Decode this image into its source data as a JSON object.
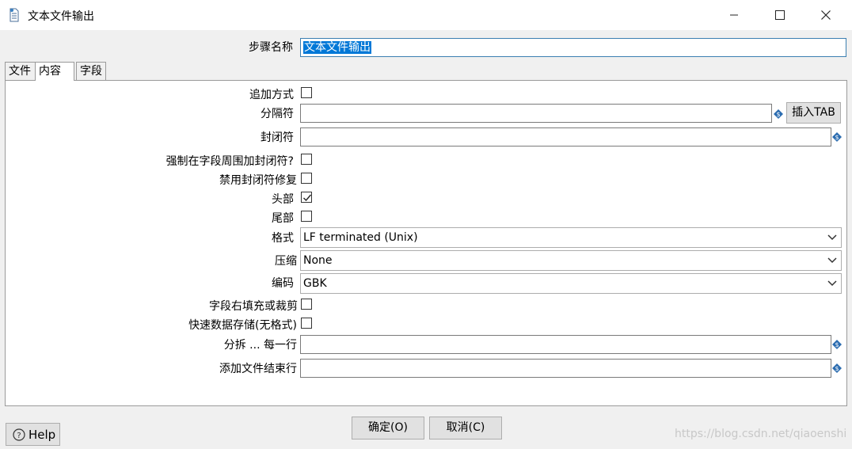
{
  "window": {
    "title": "文本文件输出",
    "icon": "document-icon",
    "controls": [
      "minimize-icon",
      "maximize-icon",
      "close-icon"
    ]
  },
  "step_name": {
    "label": "步骤名称",
    "value": "文本文件输出"
  },
  "tabs": [
    {
      "label": "文件",
      "active": false
    },
    {
      "label": "内容",
      "active": true
    },
    {
      "label": "字段",
      "active": false
    }
  ],
  "content": {
    "append": {
      "label": "追加方式",
      "checked": false
    },
    "separator": {
      "label": "分隔符",
      "value": "",
      "insert_tab_label": "插入TAB"
    },
    "enclosure": {
      "label": "封闭符",
      "value": ""
    },
    "force_enclosure": {
      "label": "强制在字段周围加封闭符?",
      "checked": false
    },
    "disable_enclosure_fix": {
      "label": "禁用封闭符修复",
      "checked": false
    },
    "header": {
      "label": "头部",
      "checked": true
    },
    "footer": {
      "label": "尾部",
      "checked": false
    },
    "format": {
      "label": "格式",
      "value": "LF terminated (Unix)"
    },
    "compression": {
      "label": "压缩",
      "value": "None"
    },
    "encoding": {
      "label": "编码",
      "value": "GBK"
    },
    "pad_fields": {
      "label": "字段右填充或裁剪",
      "checked": false
    },
    "fast_dump": {
      "label": "快速数据存储(无格式)",
      "checked": false
    },
    "split_every": {
      "label": "分拆 ... 每一行",
      "value": ""
    },
    "end_line": {
      "label": "添加文件结束行",
      "value": ""
    }
  },
  "buttons": {
    "help": "Help",
    "ok": "确定(O)",
    "cancel": "取消(C)"
  },
  "watermark": "https://blog.csdn.net/qiaoenshi",
  "colors": {
    "selection": "#0078d7",
    "focus_border": "#3c7fb1",
    "variable_icon": "#2b6cb0"
  }
}
